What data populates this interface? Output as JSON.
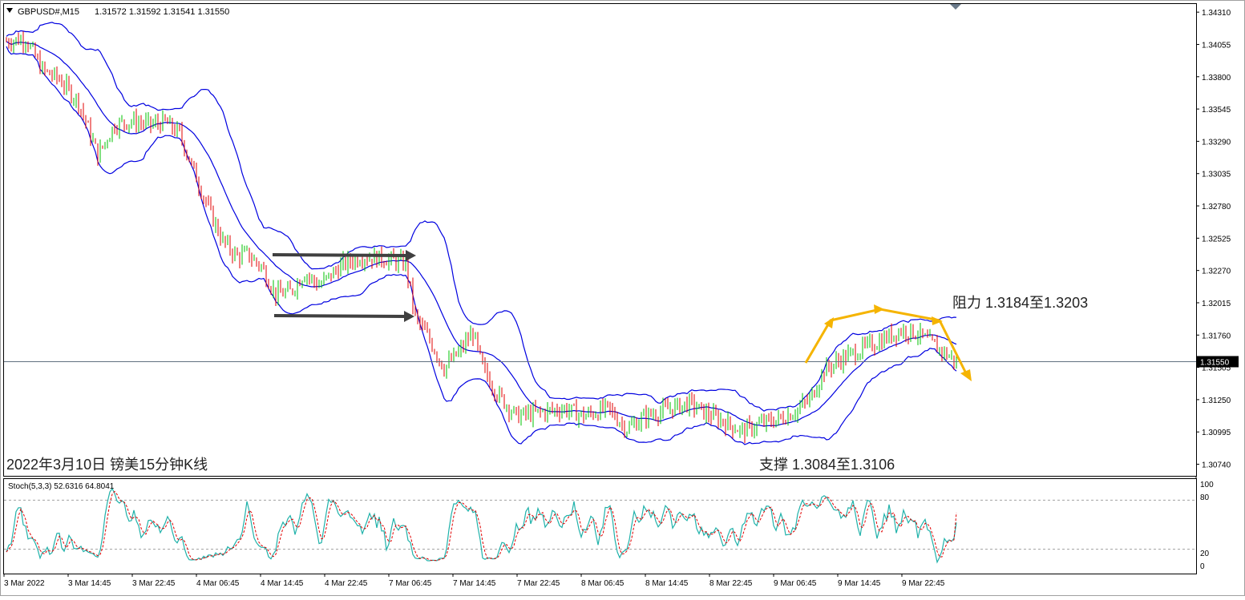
{
  "header": {
    "symbol": "GBPUSD#,M15",
    "ohlc": "1.31572 1.31592 1.31541 1.31550"
  },
  "annotations": {
    "date_title": "2022年3月10日 镑美15分钟K线",
    "resistance": "阻力 1.3184至1.3203",
    "support": "支撑 1.3084至1.3106"
  },
  "indicator": {
    "label": "Stoch(5,3,3) 52.6316 64.8041",
    "levels": [
      "100",
      "80",
      "20",
      "0"
    ]
  },
  "colors": {
    "bull": "#00c000",
    "bear": "#e00000",
    "band": "#0000e0",
    "arrow_gray": "#404040",
    "arrow_orange": "#f5b400",
    "stoch_main": "#20b2aa",
    "stoch_signal": "#e00000",
    "price_line": "#607080"
  },
  "chart_data": [
    {
      "type": "candlestick",
      "title": "GBPUSD#,M15",
      "y_ticks": [
        "1.34310",
        "1.34055",
        "1.33800",
        "1.33545",
        "1.33290",
        "1.33035",
        "1.32780",
        "1.32525",
        "1.32270",
        "1.32015",
        "1.31760",
        "1.31505",
        "1.31250",
        "1.30995",
        "1.30740"
      ],
      "ylim": [
        1.3068,
        1.3433
      ],
      "current_price": "1.31550",
      "x_ticks": [
        "3 Mar 2022",
        "3 Mar 14:45",
        "3 Mar 22:45",
        "4 Mar 06:45",
        "4 Mar 14:45",
        "4 Mar 22:45",
        "7 Mar 06:45",
        "7 Mar 14:45",
        "7 Mar 22:45",
        "8 Mar 06:45",
        "8 Mar 14:45",
        "8 Mar 22:45",
        "9 Mar 06:45",
        "9 Mar 14:45",
        "9 Mar 22:45"
      ],
      "overlays": [
        "Bollinger Bands (upper, middle, lower)"
      ],
      "price_path": [
        [
          0,
          1.3408
        ],
        [
          8,
          1.341
        ],
        [
          15,
          1.3385
        ],
        [
          22,
          1.3378
        ],
        [
          30,
          1.336
        ],
        [
          38,
          1.3318
        ],
        [
          45,
          1.3342
        ],
        [
          52,
          1.3345
        ],
        [
          60,
          1.3342
        ],
        [
          66,
          1.3344
        ],
        [
          72,
          1.3335
        ],
        [
          78,
          1.3305
        ],
        [
          84,
          1.3276
        ],
        [
          90,
          1.325
        ],
        [
          96,
          1.3238
        ],
        [
          100,
          1.324
        ],
        [
          106,
          1.323
        ],
        [
          112,
          1.3208
        ],
        [
          118,
          1.321
        ],
        [
          124,
          1.3225
        ],
        [
          130,
          1.3215
        ],
        [
          140,
          1.3232
        ],
        [
          148,
          1.3238
        ],
        [
          158,
          1.3236
        ],
        [
          166,
          1.3232
        ],
        [
          170,
          1.319
        ],
        [
          176,
          1.3172
        ],
        [
          182,
          1.315
        ],
        [
          188,
          1.3162
        ],
        [
          194,
          1.3178
        ],
        [
          198,
          1.315
        ],
        [
          204,
          1.313
        ],
        [
          212,
          1.3112
        ],
        [
          222,
          1.3115
        ],
        [
          232,
          1.3118
        ],
        [
          240,
          1.3112
        ],
        [
          250,
          1.3118
        ],
        [
          258,
          1.3102
        ],
        [
          266,
          1.3112
        ],
        [
          276,
          1.3118
        ],
        [
          284,
          1.3122
        ],
        [
          290,
          1.3115
        ],
        [
          298,
          1.3108
        ],
        [
          306,
          1.31
        ],
        [
          314,
          1.3106
        ],
        [
          322,
          1.311
        ],
        [
          328,
          1.3116
        ],
        [
          334,
          1.3125
        ],
        [
          340,
          1.3148
        ],
        [
          348,
          1.3158
        ],
        [
          356,
          1.3165
        ],
        [
          364,
          1.3172
        ],
        [
          372,
          1.318
        ],
        [
          378,
          1.3178
        ],
        [
          384,
          1.317
        ],
        [
          390,
          1.3162
        ],
        [
          395,
          1.3155
        ]
      ]
    },
    {
      "type": "line",
      "title": "Stoch(5,3,3)",
      "ylim": [
        0,
        100
      ],
      "levels": [
        100,
        80,
        20,
        0
      ],
      "last_main": 52.6316,
      "last_signal": 64.8041
    }
  ]
}
